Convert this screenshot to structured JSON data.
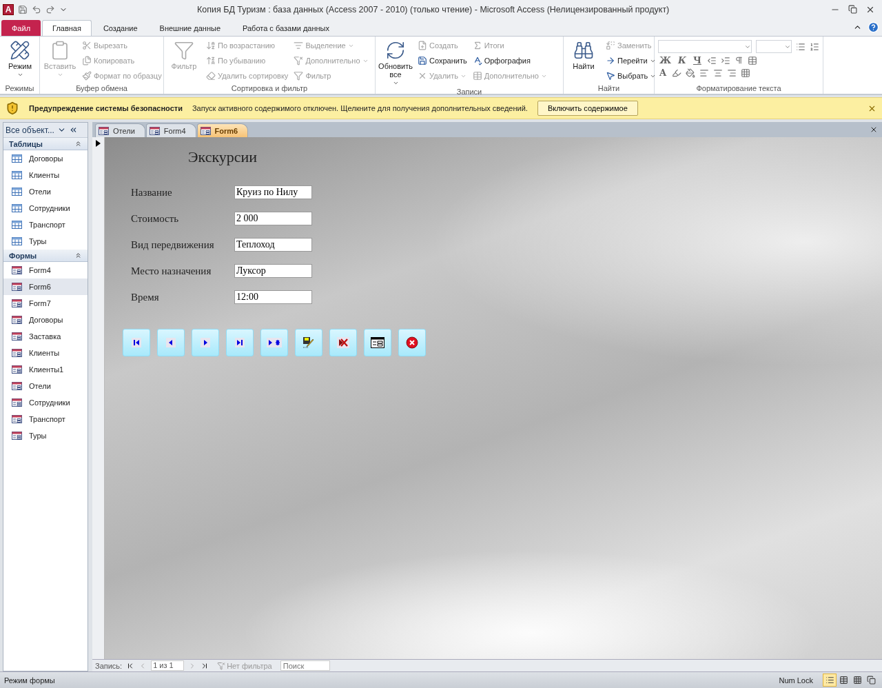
{
  "app_logo": "A",
  "window": {
    "title": "Копия БД Туризм : база данных (Access 2007 - 2010) (только чтение)  -  Microsoft Access (Нелицензированный продукт)"
  },
  "ribbon_tabs": [
    {
      "label": "Файл",
      "kind": "file",
      "selected": false
    },
    {
      "label": "Главная",
      "kind": "tab",
      "selected": true
    },
    {
      "label": "Создание",
      "kind": "tab",
      "selected": false
    },
    {
      "label": "Внешние данные",
      "kind": "tab",
      "selected": false
    },
    {
      "label": "Работа с базами данных",
      "kind": "tab",
      "selected": false
    }
  ],
  "ribbon_groups": [
    {
      "kind": "buttons",
      "label": "Режимы",
      "large": {
        "label": "Режим",
        "disabled": false,
        "dropdown": true
      }
    },
    {
      "kind": "buttons",
      "label": "Буфер обмена",
      "large": {
        "label": "Вставить",
        "disabled": true,
        "dropdown": true
      },
      "columns": [
        [
          {
            "label": "Вырезать",
            "disabled": true,
            "dropdown": false
          },
          {
            "label": "Копировать",
            "disabled": true,
            "dropdown": false
          },
          {
            "label": "Формат по образцу",
            "disabled": true,
            "dropdown": false
          }
        ]
      ]
    },
    {
      "kind": "buttons",
      "label": "Сортировка и фильтр",
      "large": {
        "label": "Фильтр",
        "disabled": true,
        "dropdown": false
      },
      "columns": [
        [
          {
            "label": "По возрастанию",
            "disabled": true,
            "dropdown": false
          },
          {
            "label": "По убыванию",
            "disabled": true,
            "dropdown": false
          },
          {
            "label": "Удалить сортировку",
            "disabled": true,
            "dropdown": false
          }
        ],
        [
          {
            "label": "Выделение",
            "disabled": true,
            "dropdown": true
          },
          {
            "label": "Дополнительно",
            "disabled": true,
            "dropdown": true
          },
          {
            "label": "Фильтр",
            "disabled": true,
            "dropdown": false
          }
        ]
      ]
    },
    {
      "kind": "buttons",
      "label": "Записи",
      "large": {
        "label": "Обновить все",
        "disabled": false,
        "dropdown": true
      },
      "columns": [
        [
          {
            "label": "Создать",
            "disabled": true,
            "dropdown": false
          },
          {
            "label": "Сохранить",
            "disabled": false,
            "dropdown": false
          },
          {
            "label": "Удалить",
            "disabled": true,
            "dropdown": true
          }
        ],
        [
          {
            "label": "Итоги",
            "disabled": true,
            "dropdown": false
          },
          {
            "label": "Орфография",
            "disabled": false,
            "dropdown": false
          },
          {
            "label": "Дополнительно",
            "disabled": true,
            "dropdown": true
          }
        ]
      ]
    },
    {
      "kind": "buttons",
      "label": "Найти",
      "large": {
        "label": "Найти",
        "disabled": false,
        "dropdown": false
      },
      "columns": [
        [
          {
            "label": "Заменить",
            "disabled": true,
            "dropdown": false
          },
          {
            "label": "Перейти",
            "disabled": false,
            "dropdown": true
          },
          {
            "label": "Выбрать",
            "disabled": false,
            "dropdown": true
          }
        ]
      ]
    },
    {
      "kind": "format",
      "label": "Форматирование текста",
      "letters": [
        "Ж",
        "К",
        "Ч",
        "A"
      ]
    }
  ],
  "security_bar": {
    "title": "Предупреждение системы безопасности",
    "message": "Запуск активного содержимого отключен. Щелкните для получения дополнительных сведений.",
    "button": "Включить содержимое"
  },
  "nav_pane": {
    "header": "Все объект...",
    "sections": [
      {
        "title": "Таблицы",
        "kind": "table",
        "items": [
          {
            "label": "Договоры",
            "selected": false
          },
          {
            "label": "Клиенты",
            "selected": false
          },
          {
            "label": "Отели",
            "selected": false
          },
          {
            "label": "Сотрудники",
            "selected": false
          },
          {
            "label": "Транспорт",
            "selected": false
          },
          {
            "label": "Туры",
            "selected": false
          }
        ]
      },
      {
        "title": "Формы",
        "kind": "form",
        "items": [
          {
            "label": "Form4",
            "selected": false
          },
          {
            "label": "Form6",
            "selected": true
          },
          {
            "label": "Form7",
            "selected": false
          },
          {
            "label": "Договоры",
            "selected": false
          },
          {
            "label": "Заставка",
            "selected": false
          },
          {
            "label": "Клиенты",
            "selected": false
          },
          {
            "label": "Клиенты1",
            "selected": false
          },
          {
            "label": "Отели",
            "selected": false
          },
          {
            "label": "Сотрудники",
            "selected": false
          },
          {
            "label": "Транспорт",
            "selected": false
          },
          {
            "label": "Туры",
            "selected": false
          }
        ]
      }
    ]
  },
  "doc_tabs": [
    {
      "label": "Отели",
      "selected": false
    },
    {
      "label": "Form4",
      "selected": false
    },
    {
      "label": "Form6",
      "selected": true
    }
  ],
  "form": {
    "title": "Экскурсии",
    "fields": [
      {
        "label": "Название",
        "value": "Круиз по Нилу"
      },
      {
        "label": "Стоимость",
        "value": "2 000"
      },
      {
        "label": "Вид передвижения",
        "value": "Теплоход"
      },
      {
        "label": "Место назначения",
        "value": "Луксор"
      },
      {
        "label": "Время",
        "value": "12:00"
      }
    ],
    "buttons": [
      {
        "kind": "first"
      },
      {
        "kind": "prev"
      },
      {
        "kind": "next"
      },
      {
        "kind": "last"
      },
      {
        "kind": "new"
      },
      {
        "kind": "save"
      },
      {
        "kind": "delete"
      },
      {
        "kind": "form"
      },
      {
        "kind": "close"
      }
    ]
  },
  "record_nav": {
    "label": "Запись:",
    "position": "1 из 1",
    "filter": "Нет фильтра",
    "search": {
      "placeholder": "Поиск"
    }
  },
  "status_bar": {
    "mode": "Режим формы",
    "indicator": "Num Lock",
    "views": [
      {
        "kind": "form",
        "selected": true
      },
      {
        "kind": "datasheet",
        "selected": false
      },
      {
        "kind": "pivot",
        "selected": false
      },
      {
        "kind": "layout",
        "selected": false
      }
    ]
  }
}
